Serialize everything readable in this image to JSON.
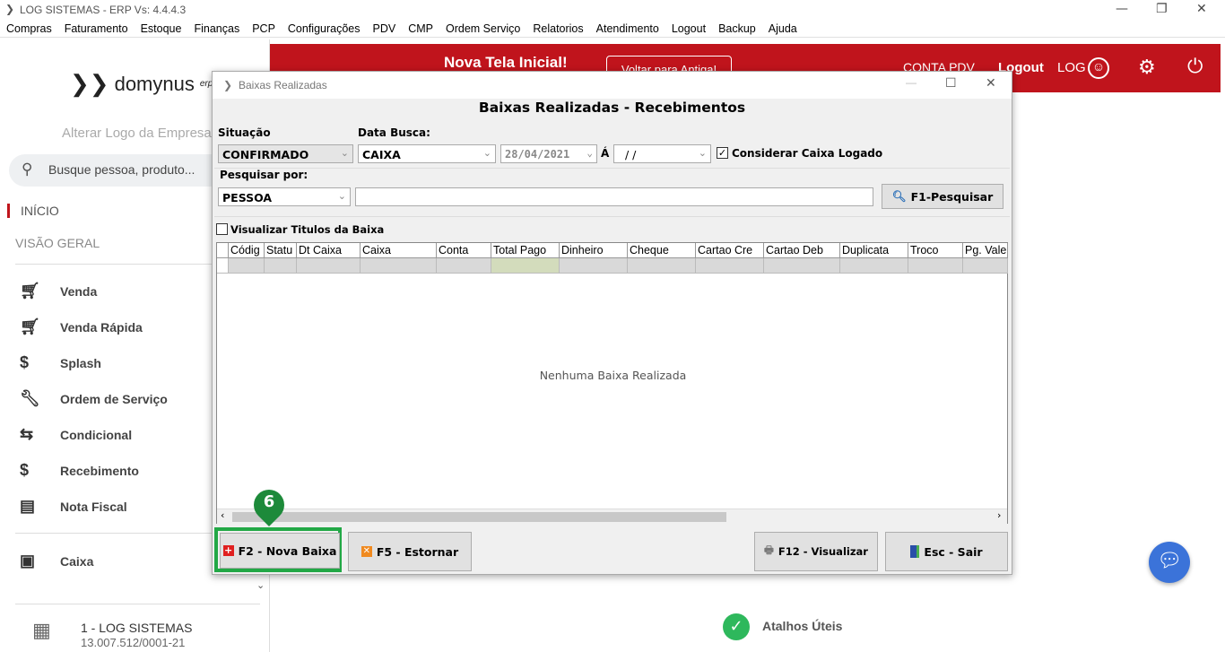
{
  "window": {
    "title": "LOG SISTEMAS - ERP Vs: 4.4.4.3"
  },
  "menu": [
    "Compras",
    "Faturamento",
    "Estoque",
    "Finanças",
    "PCP",
    "Configurações",
    "PDV",
    "CMP",
    "Ordem Serviço",
    "Relatorios",
    "Atendimento",
    "Logout",
    "Backup",
    "Ajuda"
  ],
  "sidebar": {
    "logo": "domynus",
    "logo_sup": "erp",
    "alter_logo": "Alterar Logo da Empresa",
    "search_placeholder": "Busque pessoa, produto...",
    "inicio": "INÍCIO",
    "visao": "VISÃO GERAL",
    "items": [
      {
        "label": "Venda",
        "icon": "cart-icon"
      },
      {
        "label": "Venda Rápida",
        "icon": "cart-icon"
      },
      {
        "label": "Splash",
        "icon": "cart-dollar-icon"
      },
      {
        "label": "Ordem de Serviço",
        "icon": "wrench-icon"
      },
      {
        "label": "Condicional",
        "icon": "cart-arrows-icon"
      },
      {
        "label": "Recebimento",
        "icon": "hand-dollar-icon"
      },
      {
        "label": "Nota Fiscal",
        "icon": "nfe-icon"
      },
      {
        "label": "Caixa",
        "icon": "cash-register-icon"
      }
    ],
    "company_name": "1 - LOG SISTEMAS",
    "company_cnpj": "13.007.512/0001-21"
  },
  "header": {
    "banner": "Nova Tela Inicial!",
    "back_button": "Voltar para Antiga!",
    "conta": "CONTA PDV",
    "logout": "Logout",
    "user": "LOG",
    "color": "#c0141c"
  },
  "dialog": {
    "title": "Baixas Realizadas",
    "heading": "Baixas Realizadas - Recebimentos",
    "situacao_label": "Situação",
    "situacao_value": "CONFIRMADO",
    "data_busca_label": "Data Busca:",
    "data_busca_value": "CAIXA",
    "date_from": "28/04/2021",
    "ate_label": "Á",
    "date_to": "/ /",
    "considerar_label": "Considerar Caixa Logado",
    "considerar_checked": true,
    "pesquisar_label": "Pesquisar por:",
    "pesquisar_value": "PESSOA",
    "search_value": "",
    "search_button": "F1-Pesquisar",
    "visualizar_label": "Visualizar Titulos da Baixa",
    "visualizar_checked": false,
    "columns": [
      "Códig",
      "Statu",
      "Dt Caixa",
      "Caixa",
      "Conta",
      "Total Pago",
      "Dinheiro",
      "Cheque",
      "Cartao Cre",
      "Cartao Deb",
      "Duplicata",
      "Troco",
      "Pg. Vale"
    ],
    "empty_message": "Nenhuma Baixa Realizada",
    "buttons": {
      "nova": "F2 - Nova Baixa",
      "estornar": "F5 - Estornar",
      "visualizar": "F12 - Visualizar",
      "sair": "Esc - Sair"
    }
  },
  "annotation": {
    "step": "6",
    "color": "#1d8a3a"
  },
  "atalhos": "Atalhos Úteis"
}
